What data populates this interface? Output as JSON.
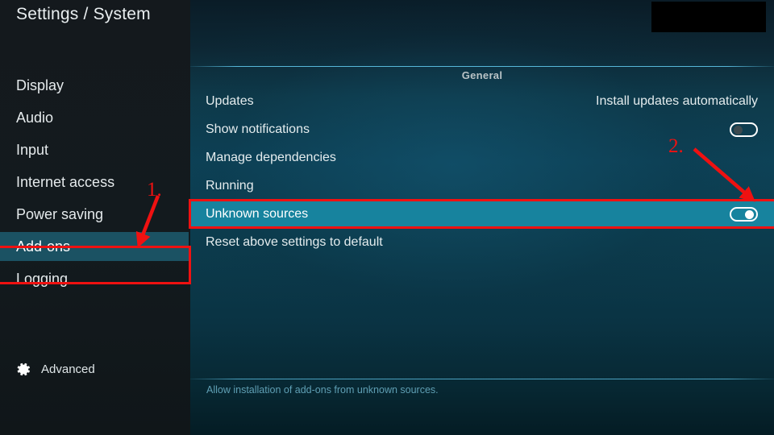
{
  "window": {
    "title": "Settings / System"
  },
  "sidebar": {
    "items": [
      {
        "label": "Display",
        "selected": false
      },
      {
        "label": "Audio",
        "selected": false
      },
      {
        "label": "Input",
        "selected": false
      },
      {
        "label": "Internet access",
        "selected": false
      },
      {
        "label": "Power saving",
        "selected": false
      },
      {
        "label": "Add-ons",
        "selected": true
      },
      {
        "label": "Logging",
        "selected": false
      }
    ],
    "advanced": {
      "label": "Advanced",
      "icon": "gear-icon"
    }
  },
  "content": {
    "group_header": "General",
    "rows": [
      {
        "label": "Updates",
        "control": "value",
        "value": "Install updates automatically"
      },
      {
        "label": "Show notifications",
        "control": "toggle",
        "toggle_state": "off"
      },
      {
        "label": "Manage dependencies",
        "control": "none"
      },
      {
        "label": "Running",
        "control": "none"
      },
      {
        "label": "Unknown sources",
        "control": "toggle",
        "toggle_state": "on",
        "selected": true
      },
      {
        "label": "Reset above settings to default",
        "control": "none"
      }
    ],
    "footer_help": "Allow installation of add-ons from unknown sources."
  },
  "annotations": {
    "step_one": "1.",
    "step_two": "2.",
    "color": "#ef1111"
  },
  "colors": {
    "sidebar_bg": "#14191d",
    "sidebar_selected": "#1b5263",
    "row_selected": "#17839e",
    "accent_line": "#5abee1",
    "help_text": "#5f9fb4",
    "annotation_red": "#ef1111"
  }
}
